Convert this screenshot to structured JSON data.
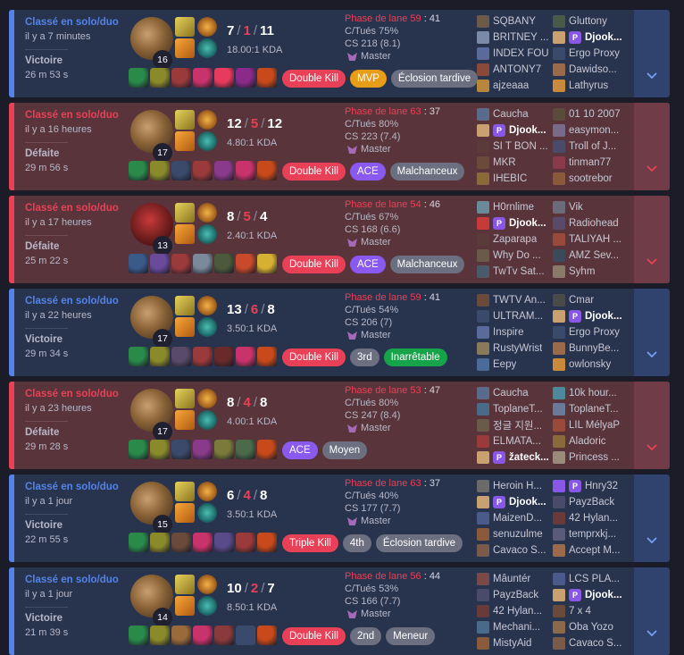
{
  "colors": {
    "win_bg": "#28344e",
    "loss_bg": "#59343b",
    "win_accent": "#5383e8",
    "loss_accent": "#e84057",
    "badge_kill": "#e84057",
    "badge_mvp": "#e89d18",
    "badge_ace": "#8a5af0",
    "badge_grey": "#6b6f7f",
    "badge_green": "#16a34a"
  },
  "matches": [
    {
      "outcome": "win",
      "queue": "Classé en solo/duo",
      "ago": "il y a 7 minutes",
      "result": "Victoire",
      "duration": "26 m 53 s",
      "champion_icon": "ziggs-portrait",
      "level": "16",
      "kills": "7",
      "deaths": "1",
      "assists": "11",
      "kda": "18.00:1 KDA",
      "items": [
        "#2a8a4a",
        "#8a8a2a",
        "#9b3a3a",
        "#c8336b",
        "#e83a5c",
        "#8a2a8a",
        "#c84a1a"
      ],
      "badges": [
        {
          "label": "Double Kill",
          "color": "#e84057"
        },
        {
          "label": "MVP",
          "color": "#e89d18"
        },
        {
          "label": "Éclosion tardive",
          "color": "#6b6f7f"
        }
      ],
      "lane_label": "Phase de lane 59",
      "lane_value": "41",
      "cs_rate": "C/Tués 75%",
      "cs": "CS 218 (8.1)",
      "rank": "Master",
      "team1": [
        {
          "name": "SQBANY",
          "c": "#6b5a4a"
        },
        {
          "name": "BRITNEY ...",
          "c": "#7a8aa8"
        },
        {
          "name": "INDEX FOU",
          "c": "#5a6a9a"
        },
        {
          "name": "ANTONY7",
          "c": "#8a4a3a"
        },
        {
          "name": "ajzeaaa",
          "c": "#b8863a"
        }
      ],
      "team2": [
        {
          "name": "Gluttony",
          "c": "#4a5a4a"
        },
        {
          "name": "Djook...",
          "c": "#c9a070",
          "me": true
        },
        {
          "name": "Ergo Proxy",
          "c": "#3a4a6a"
        },
        {
          "name": "Dawidso...",
          "c": "#9a6a4a"
        },
        {
          "name": "Lathyrus",
          "c": "#c88a3a"
        }
      ]
    },
    {
      "outcome": "loss",
      "queue": "Classé en solo/duo",
      "ago": "il y a 16 heures",
      "result": "Défaite",
      "duration": "29 m 56 s",
      "champion_icon": "ziggs-portrait",
      "level": "17",
      "kills": "12",
      "deaths": "5",
      "assists": "12",
      "kda": "4.80:1 KDA",
      "items": [
        "#2a8a4a",
        "#8a8a2a",
        "#3a4a6a",
        "#9b3a3a",
        "#8a3a8a",
        "#c8336b",
        "#c84a1a"
      ],
      "badges": [
        {
          "label": "Double Kill",
          "color": "#e84057"
        },
        {
          "label": "ACE",
          "color": "#8a5af0"
        },
        {
          "label": "Malchanceux",
          "color": "#6b6f7f"
        }
      ],
      "lane_label": "Phase de lane 63",
      "lane_value": "37",
      "cs_rate": "C/Tués 80%",
      "cs": "CS 223 (7.4)",
      "rank": "Master",
      "team1": [
        {
          "name": "Caucha",
          "c": "#5a6a8a"
        },
        {
          "name": "Djook...",
          "c": "#c9a070",
          "me": true
        },
        {
          "name": "SI T BON ...",
          "c": "#5a3a3a"
        },
        {
          "name": "MKR",
          "c": "#6a4a3a"
        },
        {
          "name": "IHEBIC",
          "c": "#8a6a3a"
        }
      ],
      "team2": [
        {
          "name": "01 10 2007",
          "c": "#5a4a3a"
        },
        {
          "name": "easymon...",
          "c": "#7a6a8a"
        },
        {
          "name": "Troll of J...",
          "c": "#4a4a6a"
        },
        {
          "name": "tinman77",
          "c": "#8a3a4a"
        },
        {
          "name": "sootrebor",
          "c": "#8a5a3a"
        }
      ]
    },
    {
      "outcome": "loss",
      "queue": "Classé en solo/duo",
      "ago": "il y a 17 heures",
      "result": "Défaite",
      "duration": "25 m 22 s",
      "champion_icon": "red-champion-portrait",
      "level": "13",
      "kills": "8",
      "deaths": "5",
      "assists": "4",
      "kda": "2.40:1 KDA",
      "items": [
        "#3a5a8a",
        "#6a4a9a",
        "#9b3a3a",
        "#7a8a9a",
        "#4a5a3a",
        "#c84a2a",
        "#d6b030"
      ],
      "badges": [
        {
          "label": "Double Kill",
          "color": "#e84057"
        },
        {
          "label": "ACE",
          "color": "#8a5af0"
        },
        {
          "label": "Malchanceux",
          "color": "#6b6f7f"
        }
      ],
      "lane_label": "Phase de lane 54",
      "lane_value": "46",
      "cs_rate": "C/Tués 67%",
      "cs": "CS 168 (6.6)",
      "rank": "Master",
      "team1": [
        {
          "name": "H0rnlime",
          "c": "#6a8a9a"
        },
        {
          "name": "Djook...",
          "c": "#c83a3a",
          "me": true
        },
        {
          "name": "Zaparapa",
          "c": "#5a3a3a"
        },
        {
          "name": "Why Do ...",
          "c": "#6a5a4a"
        },
        {
          "name": "TwTv Sat...",
          "c": "#4a5a6a"
        }
      ],
      "team2": [
        {
          "name": "Vik",
          "c": "#6a6a7a"
        },
        {
          "name": "Radiohead",
          "c": "#5a4a6a"
        },
        {
          "name": "TALIYAH ...",
          "c": "#9a4a3a"
        },
        {
          "name": "AMZ Sev...",
          "c": "#3a4a5a"
        },
        {
          "name": "Syhm",
          "c": "#8a7a6a"
        }
      ]
    },
    {
      "outcome": "win",
      "queue": "Classé en solo/duo",
      "ago": "il y a 22 heures",
      "result": "Victoire",
      "duration": "29 m 34 s",
      "champion_icon": "ziggs-portrait",
      "level": "17",
      "kills": "13",
      "deaths": "6",
      "assists": "8",
      "kda": "3.50:1 KDA",
      "items": [
        "#2a8a4a",
        "#8a8a2a",
        "#5a4a6a",
        "#9b3a3a",
        "#6a2a2a",
        "#c8336b",
        "#c84a1a"
      ],
      "badges": [
        {
          "label": "Double Kill",
          "color": "#e84057"
        },
        {
          "label": "3rd",
          "color": "#6b6f7f"
        },
        {
          "label": "Inarrêtable",
          "color": "#16a34a"
        }
      ],
      "lane_label": "Phase de lane 59",
      "lane_value": "41",
      "cs_rate": "C/Tués 54%",
      "cs": "CS 206 (7)",
      "rank": "Master",
      "team1": [
        {
          "name": "TWTV An...",
          "c": "#6a4a3a"
        },
        {
          "name": "ULTRAM...",
          "c": "#3a4a6a"
        },
        {
          "name": "Inspire",
          "c": "#5a6a9a"
        },
        {
          "name": "RustyWrist",
          "c": "#8a7a5a"
        },
        {
          "name": "Eepy",
          "c": "#4a6a9a"
        }
      ],
      "team2": [
        {
          "name": "Čmar",
          "c": "#4a4a4a"
        },
        {
          "name": "Djook...",
          "c": "#c9a070",
          "me": true
        },
        {
          "name": "Ergo Proxy",
          "c": "#3a4a6a"
        },
        {
          "name": "BunnyBe...",
          "c": "#9a6a4a"
        },
        {
          "name": "owlonsky",
          "c": "#c88a3a"
        }
      ]
    },
    {
      "outcome": "loss",
      "queue": "Classé en solo/duo",
      "ago": "il y a 23 heures",
      "result": "Défaite",
      "duration": "29 m 28 s",
      "champion_icon": "ziggs-portrait",
      "level": "17",
      "kills": "8",
      "deaths": "4",
      "assists": "8",
      "kda": "4.00:1 KDA",
      "items": [
        "#2a8a4a",
        "#8a8a2a",
        "#3a4a6a",
        "#8a3a8a",
        "#7a7a3a",
        "#4a6a4a",
        "#c84a1a"
      ],
      "badges": [
        {
          "label": "ACE",
          "color": "#8a5af0"
        },
        {
          "label": "Moyen",
          "color": "#6b6f7f"
        }
      ],
      "lane_label": "Phase de lane 53",
      "lane_value": "47",
      "cs_rate": "C/Tués 80%",
      "cs": "CS 247 (8.4)",
      "rank": "Master",
      "team1": [
        {
          "name": "Caucha",
          "c": "#5a6a8a"
        },
        {
          "name": "ToplaneT...",
          "c": "#4a6a8a"
        },
        {
          "name": "정글 지원...",
          "c": "#6a5a4a"
        },
        {
          "name": "ELMATA...",
          "c": "#9a3a3a"
        },
        {
          "name": "žateck...",
          "c": "#c9a070",
          "me": true
        }
      ],
      "team2": [
        {
          "name": "10k hour...",
          "c": "#4a8a9a"
        },
        {
          "name": "ToplaneT...",
          "c": "#6a7a9a"
        },
        {
          "name": "LIL MélyaP",
          "c": "#9a4a3a"
        },
        {
          "name": "Aladoric",
          "c": "#8a6a3a"
        },
        {
          "name": "Princess ...",
          "c": "#9a8a7a"
        }
      ]
    },
    {
      "outcome": "win",
      "queue": "Classé en solo/duo",
      "ago": "il y a 1 jour",
      "result": "Victoire",
      "duration": "22 m 55 s",
      "champion_icon": "ziggs-portrait",
      "level": "15",
      "kills": "6",
      "deaths": "4",
      "assists": "8",
      "kda": "3.50:1 KDA",
      "items": [
        "#2a8a4a",
        "#8a8a2a",
        "#6a4a3a",
        "#c8336b",
        "#5a4a8a",
        "#9b3a3a",
        "#c84a1a"
      ],
      "badges": [
        {
          "label": "Triple Kill",
          "color": "#e84057"
        },
        {
          "label": "4th",
          "color": "#6b6f7f"
        },
        {
          "label": "Éclosion tardive",
          "color": "#6b6f7f"
        }
      ],
      "lane_label": "Phase de lane 63",
      "lane_value": "37",
      "cs_rate": "C/Tués 40%",
      "cs": "CS 177 (7.7)",
      "rank": "Master",
      "team1": [
        {
          "name": "Heroin H...",
          "c": "#6a6a6a"
        },
        {
          "name": "Djook...",
          "c": "#c9a070",
          "me": true
        },
        {
          "name": "MaizenD...",
          "c": "#4a5a8a"
        },
        {
          "name": "senuzulme",
          "c": "#8a5a3a"
        },
        {
          "name": "Cavaco S...",
          "c": "#7a5a4a"
        }
      ],
      "team2": [
        {
          "name": "Hnry32",
          "c": "#8957e5",
          "p": true
        },
        {
          "name": "PayzBack",
          "c": "#4a4a6a"
        },
        {
          "name": "42 Hylan...",
          "c": "#6a3a3a"
        },
        {
          "name": "temprxkj...",
          "c": "#5a5a7a"
        },
        {
          "name": "Accept M...",
          "c": "#9a6a4a"
        }
      ]
    },
    {
      "outcome": "win",
      "queue": "Classé en solo/duo",
      "ago": "il y a 1 jour",
      "result": "Victoire",
      "duration": "21 m 39 s",
      "champion_icon": "ziggs-portrait",
      "level": "14",
      "kills": "10",
      "deaths": "2",
      "assists": "7",
      "kda": "8.50:1 KDA",
      "items": [
        "#2a8a4a",
        "#8a8a2a",
        "#9a6a3a",
        "#c8336b",
        "#8a3a3a",
        "empty",
        "#c84a1a"
      ],
      "badges": [
        {
          "label": "Double Kill",
          "color": "#e84057"
        },
        {
          "label": "2nd",
          "color": "#6b6f7f"
        },
        {
          "label": "Meneur",
          "color": "#6b6f7f"
        }
      ],
      "lane_label": "Phase de lane 56",
      "lane_value": "44",
      "cs_rate": "C/Tués 53%",
      "cs": "CS 166 (7.7)",
      "rank": "Master",
      "team1": [
        {
          "name": "Mâuntér",
          "c": "#7a4a4a"
        },
        {
          "name": "PayzBack",
          "c": "#4a4a6a"
        },
        {
          "name": "42 Hylan...",
          "c": "#6a3a3a"
        },
        {
          "name": "Mechani...",
          "c": "#4a6a8a"
        },
        {
          "name": "MistyAid",
          "c": "#8a5a3a"
        }
      ],
      "team2": [
        {
          "name": "LCS PLA...",
          "c": "#4a5a8a"
        },
        {
          "name": "Djook...",
          "c": "#c9a070",
          "me": true
        },
        {
          "name": "7 x 4",
          "c": "#6a4a3a"
        },
        {
          "name": "Oba Yozo",
          "c": "#8a6a4a"
        },
        {
          "name": "Cavaco S...",
          "c": "#7a5a4a"
        }
      ]
    }
  ]
}
